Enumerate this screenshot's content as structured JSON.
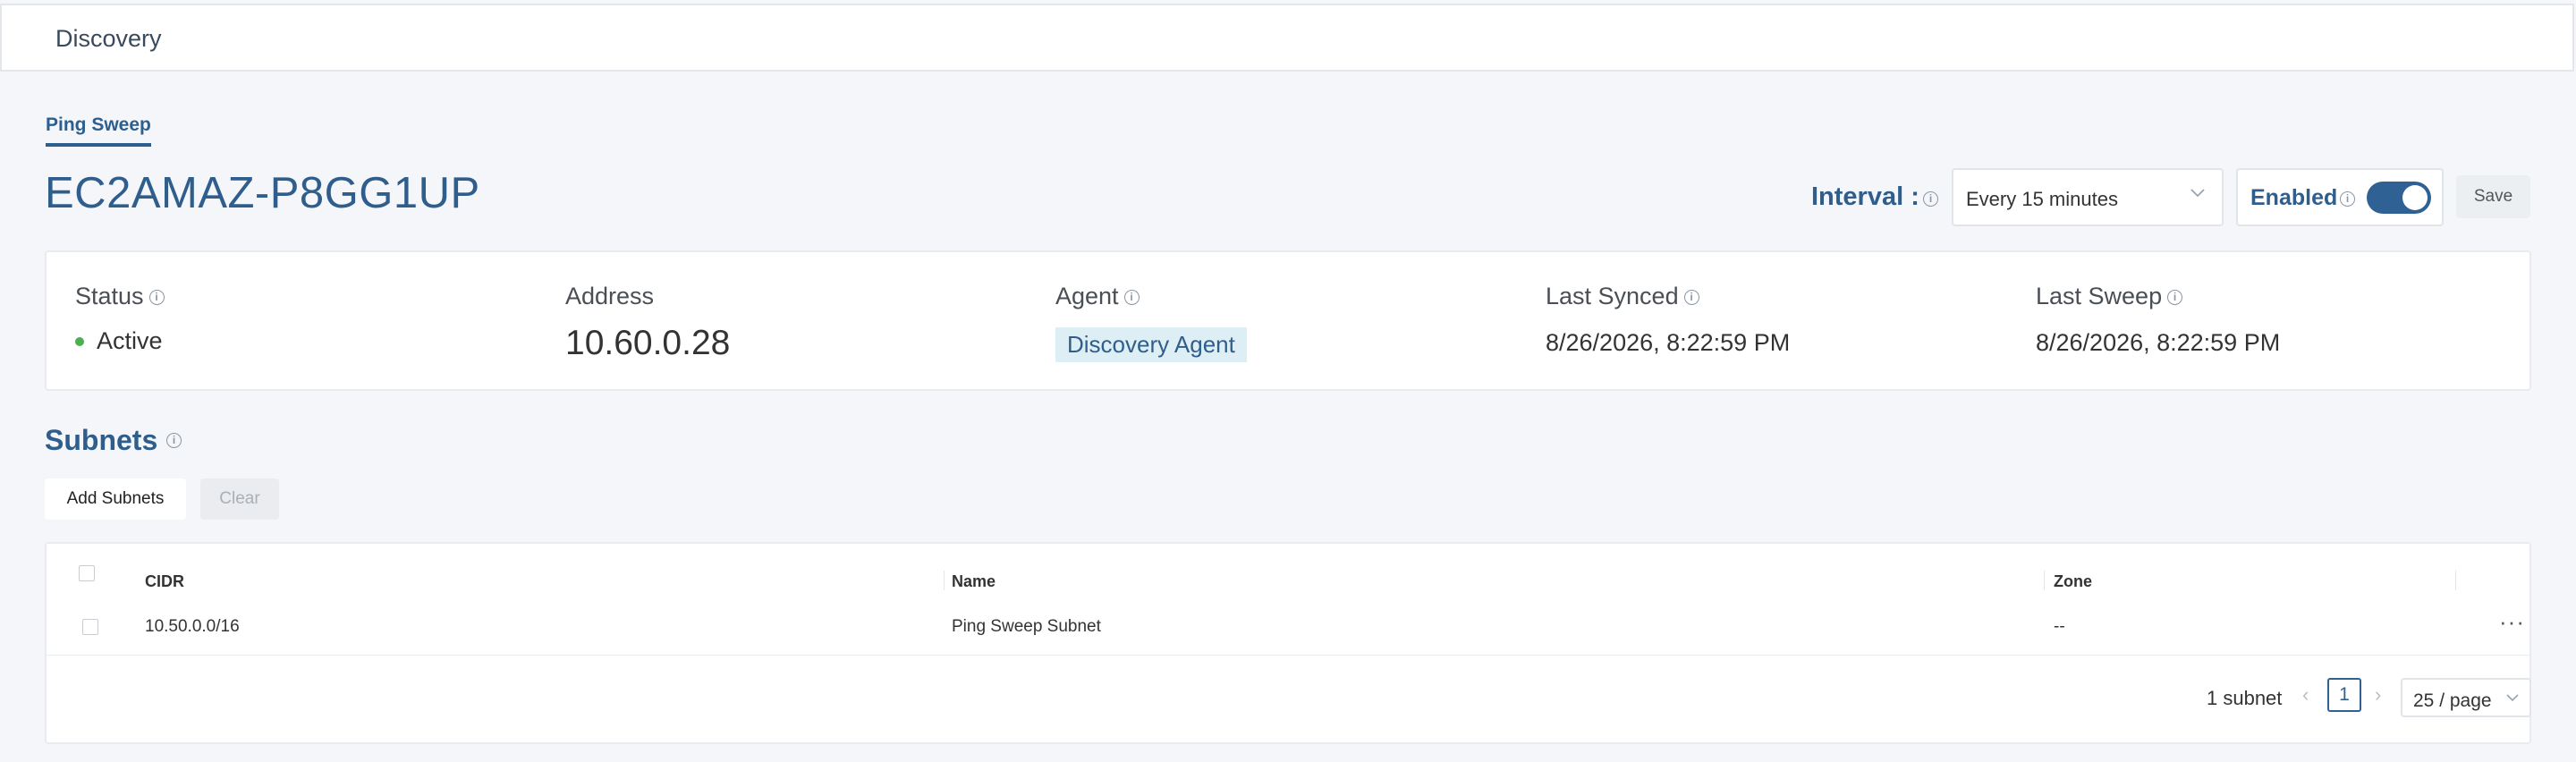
{
  "header": {
    "title": "Discovery"
  },
  "tabs": [
    {
      "label": "Ping Sweep",
      "active": true
    }
  ],
  "page": {
    "title": "EC2AMAZ-P8GG1UP"
  },
  "interval": {
    "label": "Interval :",
    "selected": "Every 15 minutes",
    "info_icon": "info-icon"
  },
  "enabled": {
    "label": "Enabled",
    "value": true
  },
  "save": {
    "label": "Save"
  },
  "summary": {
    "status": {
      "label": "Status",
      "value": "Active",
      "status_color": "#4caf50"
    },
    "address": {
      "label": "Address",
      "value": "10.60.0.28"
    },
    "agent": {
      "label": "Agent",
      "value": "Discovery Agent"
    },
    "last_synced": {
      "label": "Last Synced",
      "value": "8/26/2026, 8:22:59 PM"
    },
    "last_sweep": {
      "label": "Last Sweep",
      "value": "8/26/2026, 8:22:59 PM"
    }
  },
  "subnets": {
    "title": "Subnets",
    "add_label": "Add Subnets",
    "clear_label": "Clear",
    "columns": [
      "CIDR",
      "Name",
      "Zone"
    ],
    "rows": [
      {
        "cidr": "10.50.0.0/16",
        "name": "Ping Sweep Subnet",
        "zone": "--"
      }
    ],
    "row_actions_icon": "more-horizontal-icon"
  },
  "pagination": {
    "count_text": "1 subnet",
    "current_page": "1",
    "page_size": "25 / page"
  },
  "colors": {
    "accent": "#2f5e8c",
    "toggle_on": "#2f6195",
    "background": "#f4f6f9",
    "agent_tag_bg": "#ddeef5"
  }
}
